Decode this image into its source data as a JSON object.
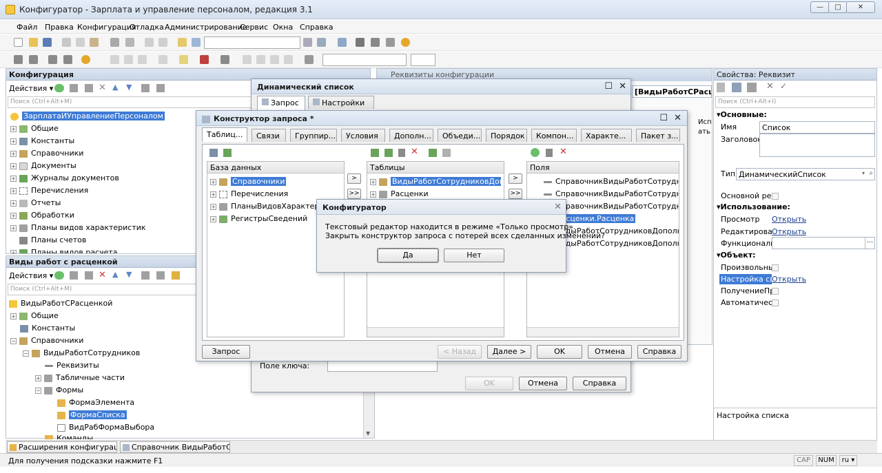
{
  "window": {
    "title": "Конфигуратор - Зарплата и управление персоналом, редакция 3.1"
  },
  "menu": [
    "Файл",
    "Правка",
    "Конфигурация",
    "Отладка",
    "Администрирование",
    "Сервис",
    "Окна",
    "Справка"
  ],
  "left_top": {
    "title": "Конфигурация",
    "actions_label": "Действия",
    "search_placeholder": "Поиск (Ctrl+Alt+M)",
    "root": "ЗарплатаИУправлениеПерсоналом",
    "items": [
      "Общие",
      "Константы",
      "Справочники",
      "Документы",
      "Журналы документов",
      "Перечисления",
      "Отчеты",
      "Обработки",
      "Планы видов характеристик",
      "Планы счетов",
      "Планы видов расчета"
    ]
  },
  "left_bottom": {
    "title": "Виды работ с расценкой",
    "actions_label": "Действия",
    "search_placeholder": "Поиск (Ctrl+Alt+M)",
    "root": "ВидыРаботСРасценкой",
    "items": [
      "Общие",
      "Константы",
      "Справочники",
      "ВидыРаботСотрудников",
      "Реквизиты",
      "Табличные части",
      "Формы",
      "ФормаЭлемента",
      "ФормаСписка",
      "ВидРабФормаВыбора",
      "Команды"
    ]
  },
  "background_window": {
    "title_partial": "Реквизиты конфигурации",
    "tab_label": "[ВидыРаботСРасценкой]",
    "col1": "Исп",
    "col2": "ать"
  },
  "dyn_list": {
    "title": "Динамический список",
    "tabs": [
      "Запрос",
      "Настройки"
    ],
    "key_field_label": "Поле ключа:",
    "ok": "OK",
    "cancel": "Отмена",
    "help": "Справка"
  },
  "query_builder": {
    "title": "Конструктор запроса *",
    "tabs": [
      "Таблиц...",
      "Связи",
      "Группир...",
      "Условия",
      "Дополн...",
      "Объеди...",
      "Порядок",
      "Компон...",
      "Характе...",
      "Пакет з..."
    ],
    "db_header": "База данных",
    "db_items": [
      "Справочники",
      "Перечисления",
      "ПланыВидовХарактеристик",
      "РегистрыСведений"
    ],
    "tables_header": "Таблицы",
    "tables_items": [
      "ВидыРаботСотрудниковДополнительныеРеквизиты",
      "Расценки"
    ],
    "fields_header": "Поля",
    "fields_items": [
      "СправочникВидыРаботСотрудников.Ссылка",
      "СправочникВидыРаботСотрудников.Наименование",
      "СправочникВидыРаботСотрудников.Код",
      "Расценки.Расценка",
      "ВидыРаботСотрудниковДополнительные",
      "ВидыРаботСотрудниковДополнительные"
    ],
    "query_btn": "Запрос",
    "back_btn": "< Назад",
    "next_btn": "Далее >",
    "ok_btn": "OK",
    "cancel_btn": "Отмена",
    "help_btn": "Справка"
  },
  "confirm": {
    "title": "Конфигуратор",
    "line1": "Текстовый редактор находится в режиме «Только просмотр».",
    "line2": "Закрыть конструктор запроса с потерей всех сделанных изменений?",
    "yes": "Да",
    "no": "Нет"
  },
  "properties": {
    "title": "Свойства: Реквизит",
    "search_placeholder": "Поиск (Ctrl+Alt+I)",
    "section_main": "Основные:",
    "name_label": "Имя",
    "name_value": "Список",
    "header_label": "Заголовок",
    "type_label": "Тип",
    "type_value": "ДинамическийСписок",
    "main_req_label": "Основной рекв",
    "section_usage": "Использование:",
    "view_label": "Просмотр",
    "view_link": "Открыть",
    "edit_label": "Редактирован",
    "edit_link": "Открыть",
    "func_label": "Функциональн",
    "section_object": "Объект:",
    "arbitrary_label": "Произвольный",
    "list_settings_label": "Настройка спи",
    "list_settings_link": "Открыть",
    "get_label": "ПолучениеПре",
    "auto_label": "Автоматическ",
    "description": "Настройка списка"
  },
  "taskbar": {
    "item1": "Расширения конфигурации",
    "item2": "Справочник ВидыРаботСотр..."
  },
  "status": {
    "hint": "Для получения подсказки нажмите F1",
    "cap": "CAP",
    "num": "NUM",
    "lang": "ru"
  },
  "colors": {
    "selection": "#3e7bd6",
    "panel_head": "#c8d5e6",
    "dialog_bg": "#f0f0f0"
  }
}
